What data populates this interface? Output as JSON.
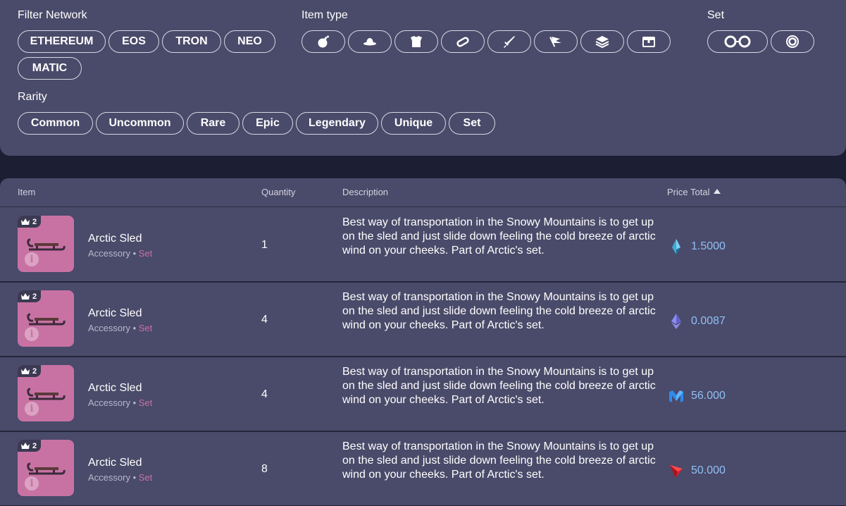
{
  "filters": {
    "network_label": "Filter Network",
    "networks": [
      "ETHEREUM",
      "EOS",
      "TRON",
      "NEO",
      "MATIC"
    ],
    "item_type_label": "Item type",
    "item_types": [
      "bomb-icon",
      "hat-icon",
      "armor-icon",
      "ring-icon",
      "sword-icon",
      "flag-icon",
      "layers-icon",
      "chest-icon"
    ],
    "set_label": "Set",
    "sets": [
      "goggles-icon",
      "target-ring-icon"
    ],
    "rarity_label": "Rarity",
    "rarities": [
      "Common",
      "Uncommon",
      "Rare",
      "Epic",
      "Legendary",
      "Unique",
      "Set"
    ]
  },
  "table": {
    "headers": {
      "item": "Item",
      "quantity": "Quantity",
      "description": "Description",
      "price_total": "Price Total"
    },
    "rows": [
      {
        "badge": "2",
        "name": "Arctic Sled",
        "category": "Accessory • ",
        "set": "Set",
        "quantity": "1",
        "description": "Best way of transportation in the Snowy Mountains is to get up on the sled and just slide down feeling the cold breeze of arctic wind on your cheeks. Part of Arctic's set.",
        "currency_icon": "eos-icon",
        "price": "1.5000"
      },
      {
        "badge": "2",
        "name": "Arctic Sled",
        "category": "Accessory • ",
        "set": "Set",
        "quantity": "4",
        "description": "Best way of transportation in the Snowy Mountains is to get up on the sled and just slide down feeling the cold breeze of arctic wind on your cheeks. Part of Arctic's set.",
        "currency_icon": "ethereum-icon",
        "price": "0.0087"
      },
      {
        "badge": "2",
        "name": "Arctic Sled",
        "category": "Accessory • ",
        "set": "Set",
        "quantity": "4",
        "description": "Best way of transportation in the Snowy Mountains is to get up on the sled and just slide down feeling the cold breeze of arctic wind on your cheeks. Part of Arctic's set.",
        "currency_icon": "matic-icon",
        "price": "56.000"
      },
      {
        "badge": "2",
        "name": "Arctic Sled",
        "category": "Accessory • ",
        "set": "Set",
        "quantity": "8",
        "description": "Best way of transportation in the Snowy Mountains is to get up on the sled and just slide down feeling the cold breeze of arctic wind on your cheeks. Part of Arctic's set.",
        "currency_icon": "tron-icon",
        "price": "50.000"
      }
    ]
  },
  "colors": {
    "panel": "#4a4a6a",
    "background": "#1c1f33",
    "thumbnail": "#c872a4",
    "price_text": "#8fc0f4"
  }
}
